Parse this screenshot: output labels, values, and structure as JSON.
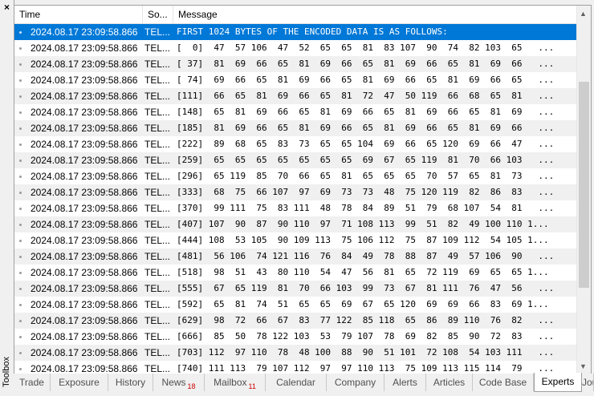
{
  "panel": {
    "close_label": "×",
    "toolbox_label": "Toolbox"
  },
  "columns": {
    "time": "Time",
    "source": "So...",
    "message": "Message"
  },
  "rows": [
    {
      "time": "2024.08.17 23:09:58.866",
      "source": "TEL...",
      "message": "FIRST 1024 BYTES OF THE ENCODED DATA IS AS FOLLOWS:"
    },
    {
      "time": "2024.08.17 23:09:58.866",
      "source": "TEL...",
      "message": "[  0]  47  57 106  47  52  65  65  81  83 107  90  74  82 103  65   ..."
    },
    {
      "time": "2024.08.17 23:09:58.866",
      "source": "TEL...",
      "message": "[ 37]  81  69  66  65  81  69  66  65  81  69  66  65  81  69  66   ..."
    },
    {
      "time": "2024.08.17 23:09:58.866",
      "source": "TEL...",
      "message": "[ 74]  69  66  65  81  69  66  65  81  69  66  65  81  69  66  65   ..."
    },
    {
      "time": "2024.08.17 23:09:58.866",
      "source": "TEL...",
      "message": "[111]  66  65  81  69  66  65  81  72  47  50 119  66  68  65  81   ..."
    },
    {
      "time": "2024.08.17 23:09:58.866",
      "source": "TEL...",
      "message": "[148]  65  81  69  66  65  81  69  66  65  81  69  66  65  81  69   ..."
    },
    {
      "time": "2024.08.17 23:09:58.866",
      "source": "TEL...",
      "message": "[185]  81  69  66  65  81  69  66  65  81  69  66  65  81  69  66   ..."
    },
    {
      "time": "2024.08.17 23:09:58.866",
      "source": "TEL...",
      "message": "[222]  89  68  65  83  73  65  65 104  69  66  65 120  69  66  47   ..."
    },
    {
      "time": "2024.08.17 23:09:58.866",
      "source": "TEL...",
      "message": "[259]  65  65  65  65  65  65  65  69  67  65 119  81  70  66 103   ..."
    },
    {
      "time": "2024.08.17 23:09:58.866",
      "source": "TEL...",
      "message": "[296]  65 119  85  70  66  65  81  65  65  65  70  57  65  81  73   ..."
    },
    {
      "time": "2024.08.17 23:09:58.866",
      "source": "TEL...",
      "message": "[333]  68  75  66 107  97  69  73  73  48  75 120 119  82  86  83   ..."
    },
    {
      "time": "2024.08.17 23:09:58.866",
      "source": "TEL...",
      "message": "[370]  99 111  75  83 111  48  78  84  89  51  79  68 107  54  81   ..."
    },
    {
      "time": "2024.08.17 23:09:58.866",
      "source": "TEL...",
      "message": "[407] 107  90  87  90 110  97  71 108 113  99  51  82  49 100 110 1..."
    },
    {
      "time": "2024.08.17 23:09:58.866",
      "source": "TEL...",
      "message": "[444] 108  53 105  90 109 113  75 106 112  75  87 109 112  54 105 1..."
    },
    {
      "time": "2024.08.17 23:09:58.866",
      "source": "TEL...",
      "message": "[481]  56 106  74 121 116  76  84  49  78  88  87  49  57 106  90   ..."
    },
    {
      "time": "2024.08.17 23:09:58.866",
      "source": "TEL...",
      "message": "[518]  98  51  43  80 110  54  47  56  81  65  72 119  69  65  65 1..."
    },
    {
      "time": "2024.08.17 23:09:58.866",
      "source": "TEL...",
      "message": "[555]  67  65 119  81  70  66 103  99  73  67  81 111  76  47  56   ..."
    },
    {
      "time": "2024.08.17 23:09:58.866",
      "source": "TEL...",
      "message": "[592]  65  81  74  51  65  65  69  67  65 120  69  69  66  83  69 1..."
    },
    {
      "time": "2024.08.17 23:09:58.866",
      "source": "TEL...",
      "message": "[629]  98  72  66  67  83  77 122  85 118  65  86  89 110  76  82   ..."
    },
    {
      "time": "2024.08.17 23:09:58.866",
      "source": "TEL...",
      "message": "[666]  85  50  78 122 103  53  79 107  78  69  82  85  90  72  83   ..."
    },
    {
      "time": "2024.08.17 23:09:58.866",
      "source": "TEL...",
      "message": "[703] 112  97 110  78  48 100  88  90  51 101  72 108  54 103 111   ..."
    },
    {
      "time": "2024.08.17 23:09:58.866",
      "source": "TEL...",
      "message": "[740] 111 113  79 107 112  97  97 110 113  75 109 113 115 114  79   ..."
    }
  ],
  "tabs": [
    {
      "label": "Trade"
    },
    {
      "label": "Exposure"
    },
    {
      "label": "History"
    },
    {
      "label": "News",
      "badge": "18"
    },
    {
      "label": "Mailbox",
      "badge": "11"
    },
    {
      "label": "Calendar"
    },
    {
      "label": "Company"
    },
    {
      "label": "Alerts"
    },
    {
      "label": "Articles"
    },
    {
      "label": "Code Base"
    },
    {
      "label": "Experts"
    },
    {
      "label": "Jou"
    }
  ],
  "colors": {
    "selection": "#0078d7",
    "badge": "#d00000"
  },
  "icons": {
    "close": "close-icon",
    "scroll_up": "chevron-up-icon",
    "scroll_down": "chevron-down-icon"
  }
}
